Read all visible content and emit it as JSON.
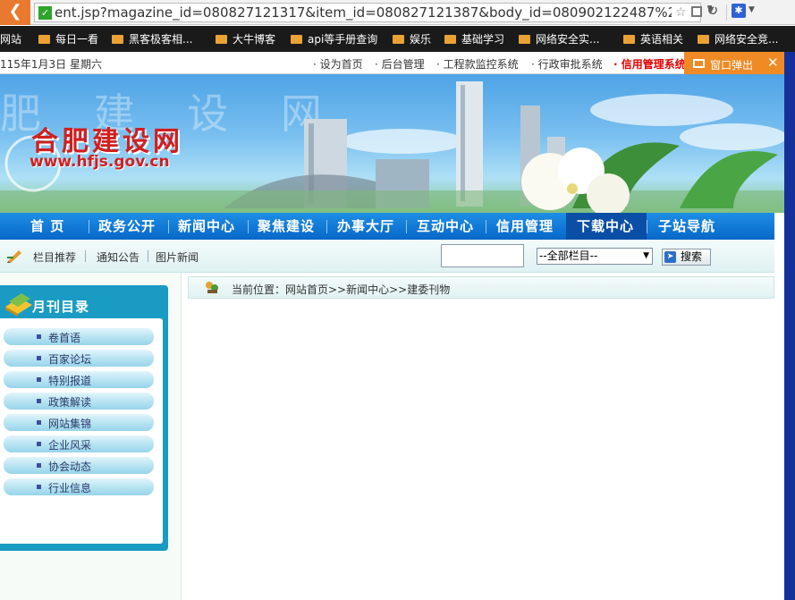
{
  "browser": {
    "url": "ent.jsp?magazine_id=080827121317&item_id=080827121387&body_id=080902122487%27",
    "bookmarks": [
      "网站",
      "每日一看",
      "黑客极客相...",
      "大牛博客",
      "api等手册查询",
      "娱乐",
      "基础学习",
      "网络安全实...",
      "英语相关",
      "网络安全竞..."
    ]
  },
  "header": {
    "date": "115年1月3日 星期六",
    "links": [
      "· 设为首页",
      "· 后台管理",
      "· 工程款监控系统",
      "· 行政审批系统",
      "· 信用管理系统"
    ],
    "popup_label": "窗口弹出",
    "popup_close": "✕"
  },
  "banner": {
    "watermark": "肥 建 设 网",
    "title": "合肥建设网",
    "url": "www.hfjs.gov.cn"
  },
  "nav": {
    "items": [
      "首  页",
      "政务公开",
      "新闻中心",
      "聚焦建设",
      "办事大厅",
      "互动中心",
      "信用管理",
      "下载中心",
      "子站导航"
    ],
    "active_index": 7
  },
  "subbar": {
    "links": [
      "栏目推荐",
      "通知公告",
      "图片新闻"
    ],
    "search_value": "",
    "select_value": "--全部栏目--",
    "search_button": "搜索"
  },
  "sidebar": {
    "title": "月刊目录",
    "items": [
      "卷首语",
      "百家论坛",
      "特别报道",
      "政策解读",
      "网站集锦",
      "企业风采",
      "协会动态",
      "行业信息"
    ]
  },
  "breadcrumb": {
    "text": "当前位置：网站首页>>新闻中心>>建委刊物"
  }
}
